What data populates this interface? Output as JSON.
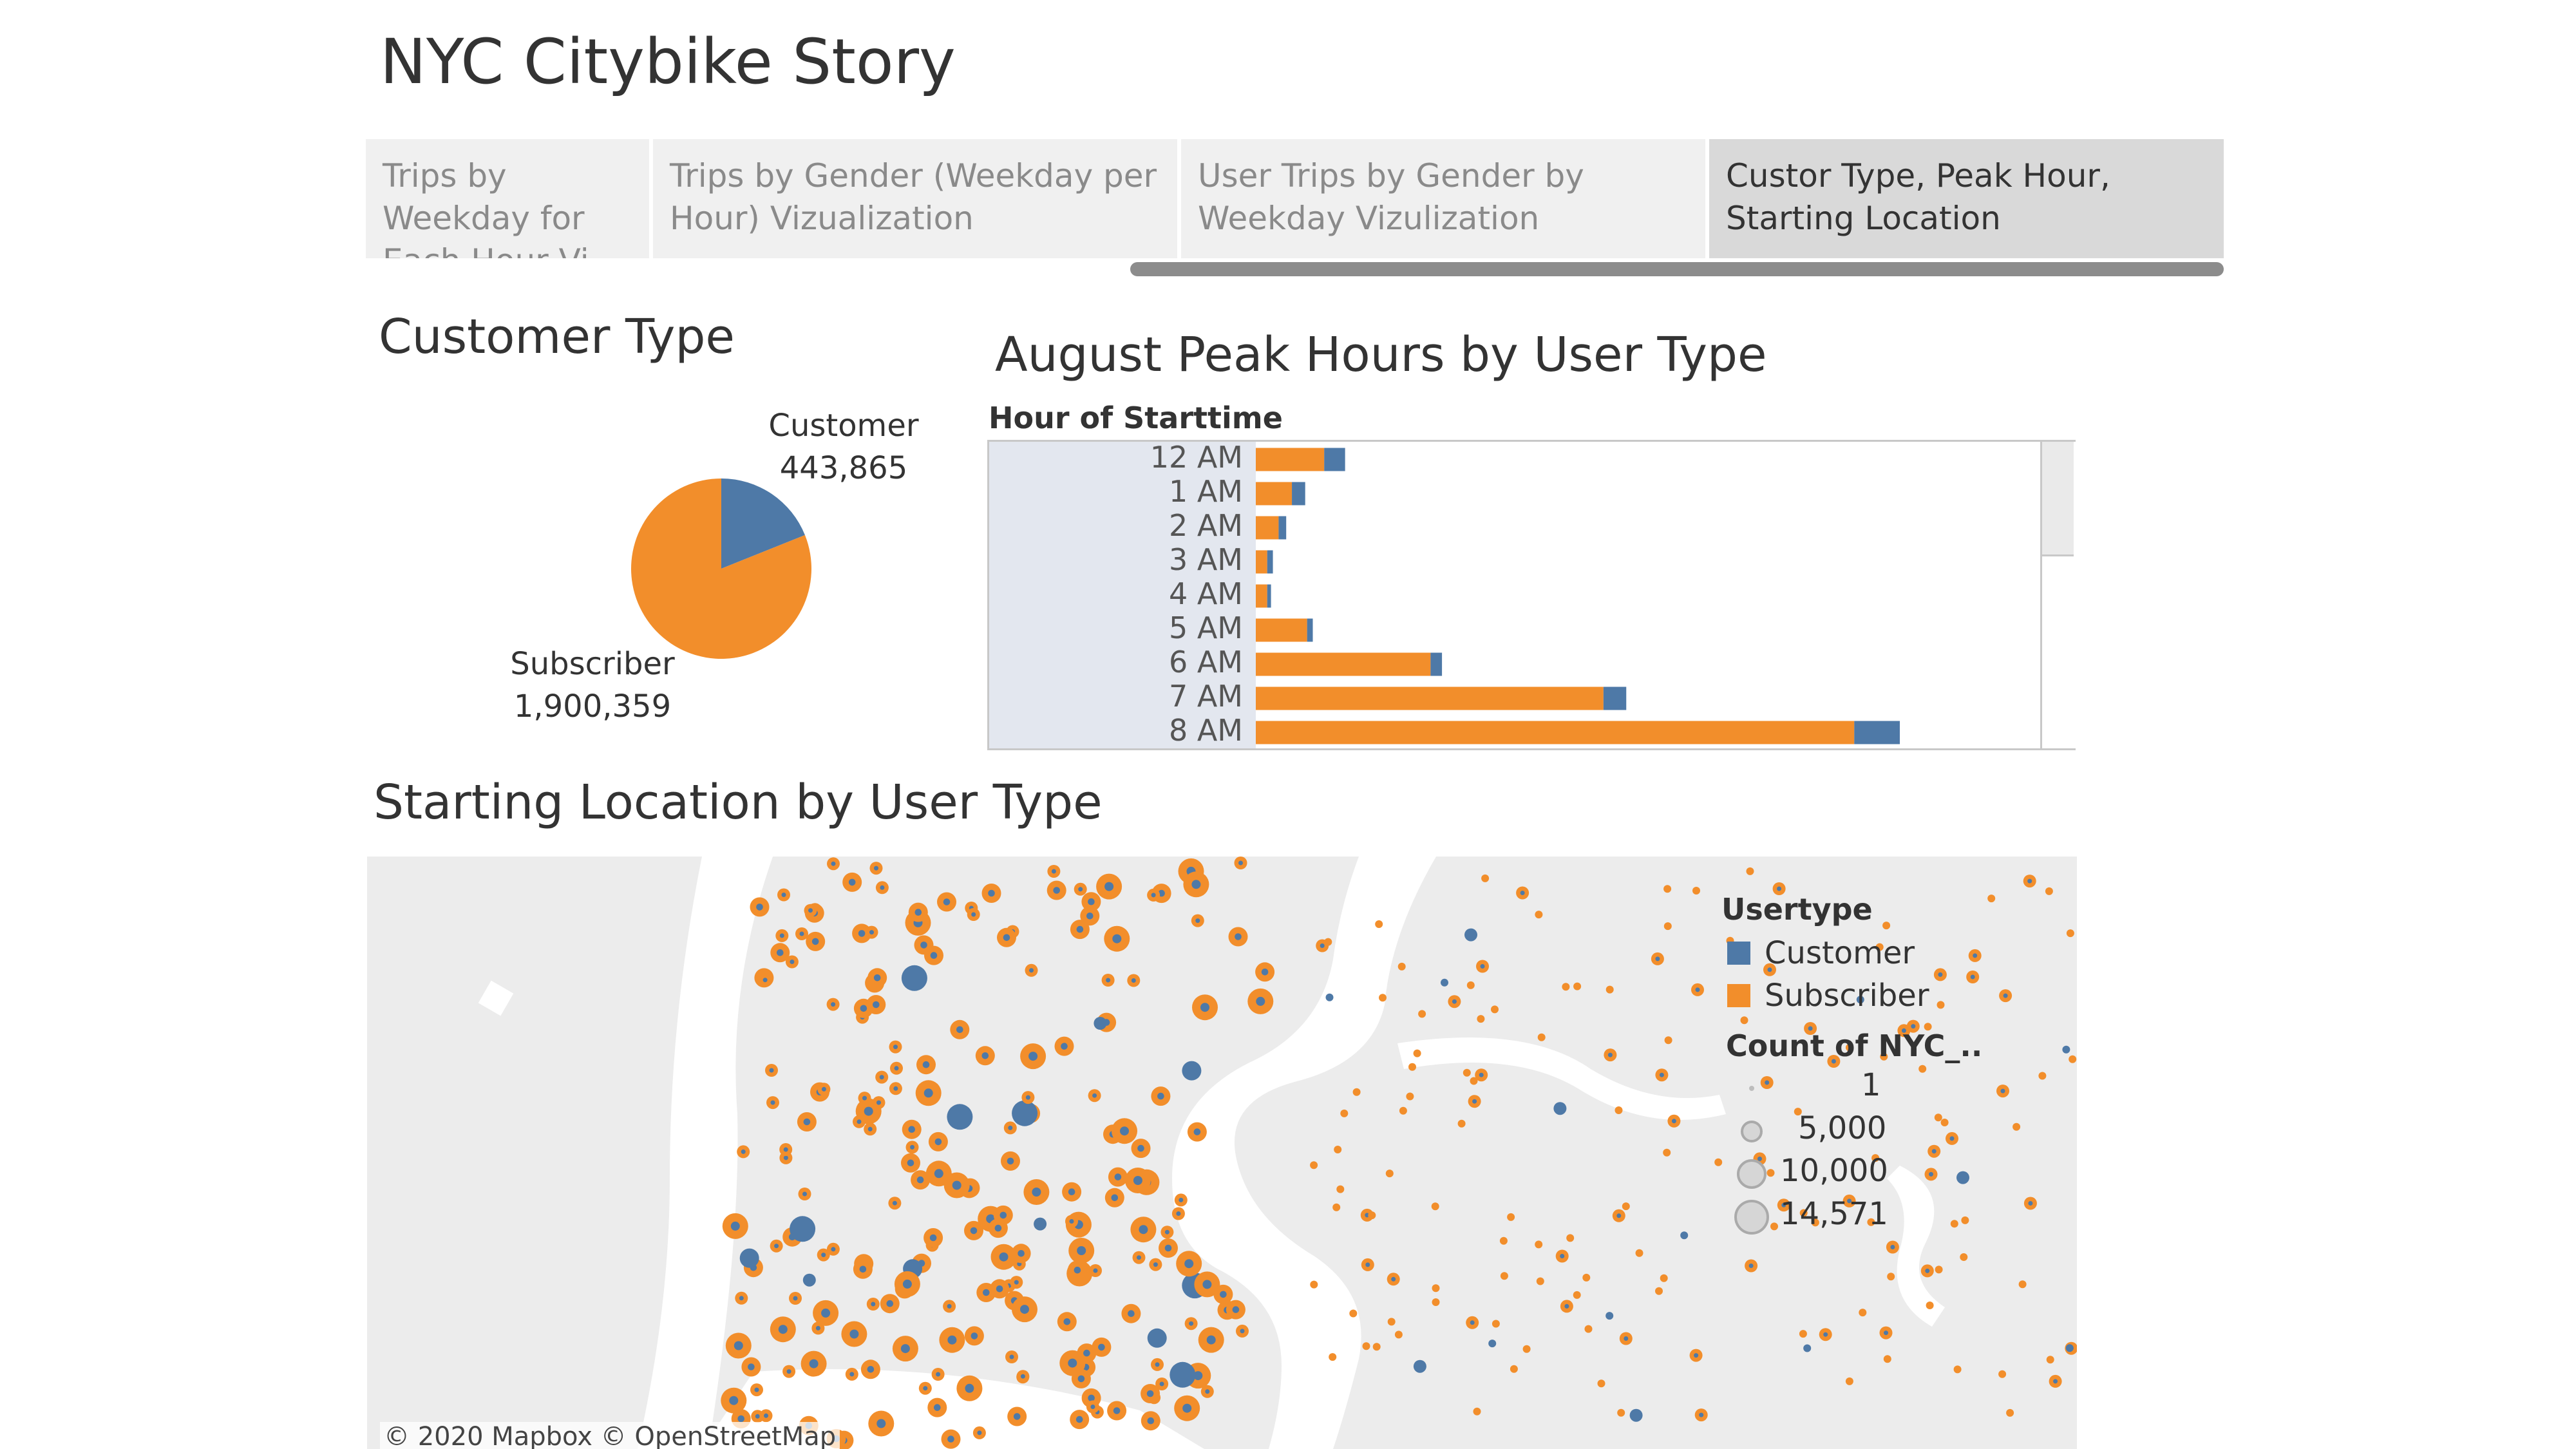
{
  "story": {
    "title": "NYC Citybike Story"
  },
  "tabs": [
    {
      "label": "Trips by Weekday for Each Hour Vi..",
      "active": false
    },
    {
      "label": "Trips by Gender (Weekday per Hour) Vizualization",
      "active": false
    },
    {
      "label": "User Trips by Gender by Weekday Vizulization",
      "active": false
    },
    {
      "label": "Custor Type, Peak Hour, Starting Location",
      "active": true
    }
  ],
  "customer_type": {
    "title": "Customer Type",
    "customer_label": "Customer",
    "customer_value": "443,865",
    "subscriber_label": "Subscriber",
    "subscriber_value": "1,900,359"
  },
  "peak_hours": {
    "title": "August Peak Hours by User Type",
    "axis_title": "Hour of Starttime"
  },
  "map": {
    "title": "Starting Location by User Type",
    "attribution": "© 2020 Mapbox © OpenStreetMap",
    "legend": {
      "usertype_title": "Usertype",
      "customer": "Customer",
      "subscriber": "Subscriber",
      "count_title": "Count of NYC_..",
      "sizes": [
        "1",
        "5,000",
        "10,000",
        "14,571"
      ]
    }
  },
  "colors": {
    "customer": "#4e79a7",
    "subscriber": "#f28e2b",
    "map_land": "#ececec",
    "map_water": "#ffffff"
  },
  "chart_data": [
    {
      "type": "pie",
      "categories": [
        "Customer",
        "Subscriber"
      ],
      "values": [
        443865,
        1900359
      ]
    },
    {
      "type": "bar",
      "orientation": "horizontal",
      "stacked": true,
      "categories": [
        "12 AM",
        "1 AM",
        "2 AM",
        "3 AM",
        "4 AM",
        "5 AM",
        "6 AM",
        "7 AM",
        "8 AM"
      ],
      "series": [
        {
          "name": "Subscriber",
          "values": [
            36000,
            19000,
            12000,
            6000,
            6000,
            27000,
            92000,
            183000,
            315000
          ]
        },
        {
          "name": "Customer",
          "values": [
            11000,
            7000,
            4000,
            3000,
            2000,
            3000,
            6000,
            12000,
            24000
          ]
        }
      ],
      "xlim": [
        0,
        400000
      ]
    }
  ]
}
